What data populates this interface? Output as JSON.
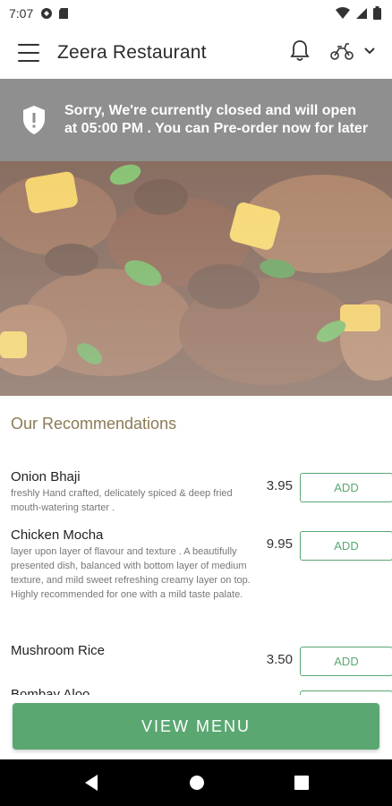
{
  "status_bar": {
    "time": "7:07"
  },
  "app_bar": {
    "title": "Zeera Restaurant"
  },
  "banner": {
    "message": "Sorry, We're currently closed and will open at 05:00 PM . You can Pre-order now for later"
  },
  "section": {
    "title": "Our Recommendations"
  },
  "items": [
    {
      "name": "Onion Bhaji",
      "description": " freshly Hand crafted, delicately spiced & deep fried mouth-watering starter .",
      "price": "3.95",
      "action": "ADD"
    },
    {
      "name": "Chicken Mocha",
      "description": "layer upon layer of flavour and texture . A beautifully presented dish,  balanced with bottom layer of medium texture, and mild sweet refreshing creamy  layer on top. Highly recommended for one with a mild taste palate.",
      "price": "9.95",
      "action": "ADD"
    },
    {
      "name": "Mushroom Rice",
      "description": "",
      "price": "3.50",
      "action": "ADD"
    },
    {
      "name": "Bombay Aloo",
      "description": "",
      "price": "",
      "action": ""
    }
  ],
  "footer": {
    "view_menu_label": "VIEW MENU"
  },
  "colors": {
    "accent_green": "#5aa772",
    "banner_grey": "#8f8f8f",
    "section_title": "#8b7a55"
  },
  "icons": [
    "menu-icon",
    "bell-icon",
    "scooter-icon",
    "chevron-down-icon",
    "shield-alert-icon",
    "back-icon",
    "home-icon",
    "recents-icon"
  ]
}
